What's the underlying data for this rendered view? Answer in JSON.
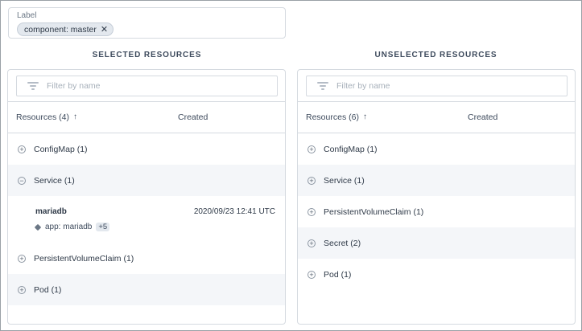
{
  "label_field": {
    "caption": "Label",
    "chip_text": "component: master",
    "chip_close": "✕"
  },
  "selected": {
    "title": "SELECTED RESOURCES",
    "filter_placeholder": "Filter by name",
    "header_resources": "Resources (4)",
    "header_created": "Created",
    "sort_arrow": "↑",
    "rows": [
      {
        "toggle": "+",
        "label": "ConfigMap (1)"
      },
      {
        "toggle": "−",
        "label": "Service (1)"
      },
      {
        "toggle": "+",
        "label": "PersistentVolumeClaim (1)"
      },
      {
        "toggle": "+",
        "label": "Pod (1)"
      }
    ],
    "service_child": {
      "name": "mariadb",
      "created": "2020/09/23 12:41 UTC",
      "label": "app: mariadb",
      "more": "+5"
    }
  },
  "unselected": {
    "title": "UNSELECTED RESOURCES",
    "filter_placeholder": "Filter by name",
    "header_resources": "Resources (6)",
    "header_created": "Created",
    "sort_arrow": "↑",
    "rows": [
      {
        "toggle": "+",
        "label": "ConfigMap (1)"
      },
      {
        "toggle": "+",
        "label": "Service (1)"
      },
      {
        "toggle": "+",
        "label": "PersistentVolumeClaim (1)"
      },
      {
        "toggle": "+",
        "label": "Secret (2)"
      },
      {
        "toggle": "+",
        "label": "Pod (1)"
      }
    ]
  }
}
